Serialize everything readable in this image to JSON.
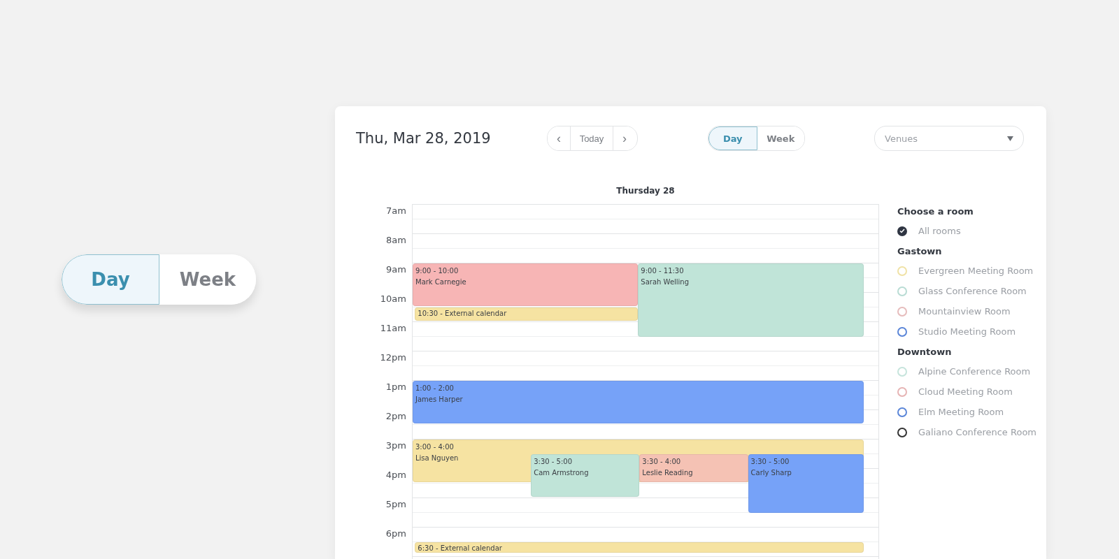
{
  "big_toggle": [
    {
      "label": "Day",
      "selected": true
    },
    {
      "label": "Week",
      "selected": false
    }
  ],
  "header": {
    "date": "Thu, Mar 28, 2019",
    "nav": {
      "prev": "‹",
      "today": "Today",
      "next": "›"
    },
    "views": [
      {
        "label": "Day",
        "selected": true
      },
      {
        "label": "Week",
        "selected": false
      }
    ],
    "venues": {
      "placeholder": "Venues"
    }
  },
  "day_heading": "Thursday 28",
  "hours": [
    "7am",
    "8am",
    "9am",
    "10am",
    "11am",
    "12pm",
    "1pm",
    "2pm",
    "3pm",
    "4pm",
    "5pm",
    "6pm"
  ],
  "events": [
    {
      "kind": "booking",
      "time": "9:00 - 10:00",
      "name": "Mark Carnegie",
      "color": "#f7b5b5"
    },
    {
      "kind": "booking",
      "time": "9:00 - 11:30",
      "name": "Sarah Welling",
      "color": "#c0e4d8"
    },
    {
      "kind": "external",
      "label": "10:30 - External calendar",
      "color": "#f6e3a2"
    },
    {
      "kind": "booking",
      "time": "1:00 - 2:00",
      "name": "James Harper",
      "color": "#76a2f8"
    },
    {
      "kind": "booking",
      "time": "3:00 - 4:00",
      "name": "Lisa Nguyen",
      "color": "#f6e3a2"
    },
    {
      "kind": "booking",
      "time": "3:30 - 5:00",
      "name": "Cam Armstrong",
      "color": "#c0e4d8"
    },
    {
      "kind": "booking",
      "time": "3:30 - 4:00",
      "name": "Leslie Reading",
      "color": "#f5c2b4"
    },
    {
      "kind": "booking",
      "time": "3:30 - 5:00",
      "name": "Carly Sharp",
      "color": "#76a2f8"
    },
    {
      "kind": "external",
      "label": "6:30 - External calendar",
      "color": "#f6e3a2"
    }
  ],
  "rooms": {
    "title": "Choose a room",
    "all": {
      "label": "All rooms",
      "checked": true
    },
    "groups": [
      {
        "name": "Gastown",
        "rooms": [
          {
            "label": "Evergreen Meeting Room",
            "color": "#f0e2a6",
            "checked": false
          },
          {
            "label": "Glass Conference Room",
            "color": "#b9dcd4",
            "checked": false
          },
          {
            "label": "Mountainview Room",
            "color": "#e6bcbc",
            "checked": false
          },
          {
            "label": "Studio Meeting Room",
            "color": "#5b86d8",
            "checked": false
          }
        ]
      },
      {
        "name": "Downtown",
        "rooms": [
          {
            "label": "Alpine Conference Room",
            "color": "#c6e4dc",
            "checked": false
          },
          {
            "label": "Cloud Meeting Room",
            "color": "#e6b4b4",
            "checked": false
          },
          {
            "label": "Elm Meeting Room",
            "color": "#5b86d8",
            "checked": false
          },
          {
            "label": "Galiano Conference Room",
            "color": "#333333",
            "checked": false
          }
        ]
      }
    ]
  }
}
